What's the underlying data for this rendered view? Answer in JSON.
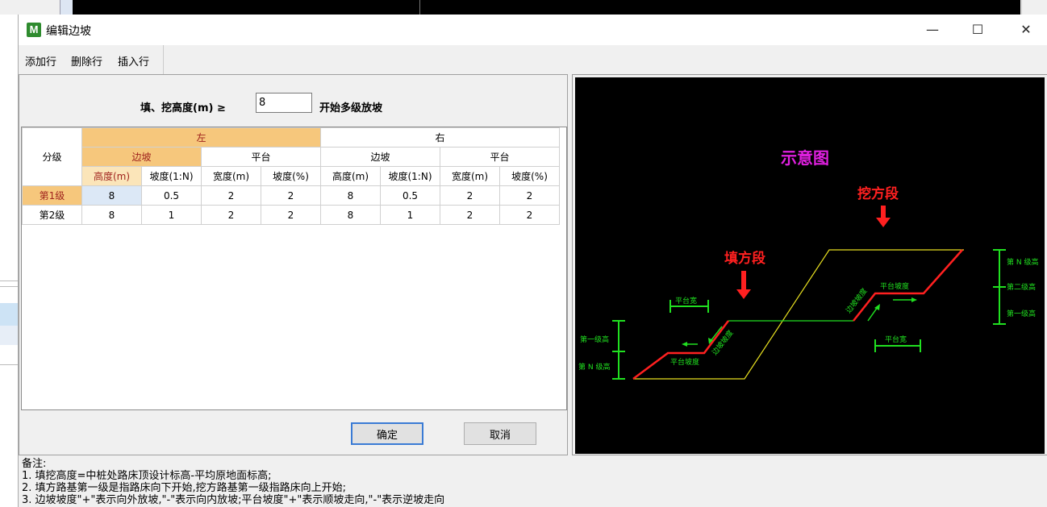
{
  "window": {
    "title": "编辑边坡",
    "app_icon_letter": "M"
  },
  "toolbar": {
    "add_row": "添加行",
    "delete_row": "删除行",
    "insert_row": "插入行"
  },
  "height_row": {
    "label": "填、挖高度(m) ≥",
    "value": "8",
    "suffix": "开始多级放坡"
  },
  "grid": {
    "col_group": "分级",
    "left": "左",
    "right": "右",
    "slope": "边坡",
    "platform": "平台",
    "subheaders": [
      "高度(m)",
      "坡度(1:N)",
      "宽度(m)",
      "坡度(%)",
      "高度(m)",
      "坡度(1:N)",
      "宽度(m)",
      "坡度(%)"
    ],
    "rows": [
      {
        "level": "第1级",
        "cells": [
          "8",
          "0.5",
          "2",
          "2",
          "8",
          "0.5",
          "2",
          "2"
        ]
      },
      {
        "level": "第2级",
        "cells": [
          "8",
          "1",
          "2",
          "2",
          "8",
          "1",
          "2",
          "2"
        ]
      }
    ]
  },
  "buttons": {
    "ok": "确定",
    "cancel": "取消"
  },
  "diagram": {
    "title": "示意图",
    "cut_label": "挖方段",
    "fill_label": "填方段",
    "platform_width": "平台宽",
    "platform_slope": "平台坡度",
    "slope_ratio": "边坡坡度",
    "level_n_right": "第 N 级高",
    "level_2_right": "第二级高",
    "level_1_right": "第一级高",
    "level_1_left": "第一级高",
    "level_n_left": "第 N 级高",
    "colors": {
      "background": "#000000",
      "title": "#e020e0",
      "label": "#ff2020",
      "ground": "#e8e020",
      "road": "#20e020",
      "slope": "#ff2020",
      "annotation": "#20e020"
    }
  },
  "notes": {
    "heading": "备注:",
    "line1": "1. 填挖高度=中桩处路床顶设计标高-平均原地面标高;",
    "line2": "2. 填方路基第一级是指路床向下开始,挖方路基第一级指路床向上开始;",
    "line3": "3. 边坡坡度\"+\"表示向外放坡,\"-\"表示向内放坡;平台坡度\"+\"表示顺坡走向,\"-\"表示逆坡走向"
  }
}
